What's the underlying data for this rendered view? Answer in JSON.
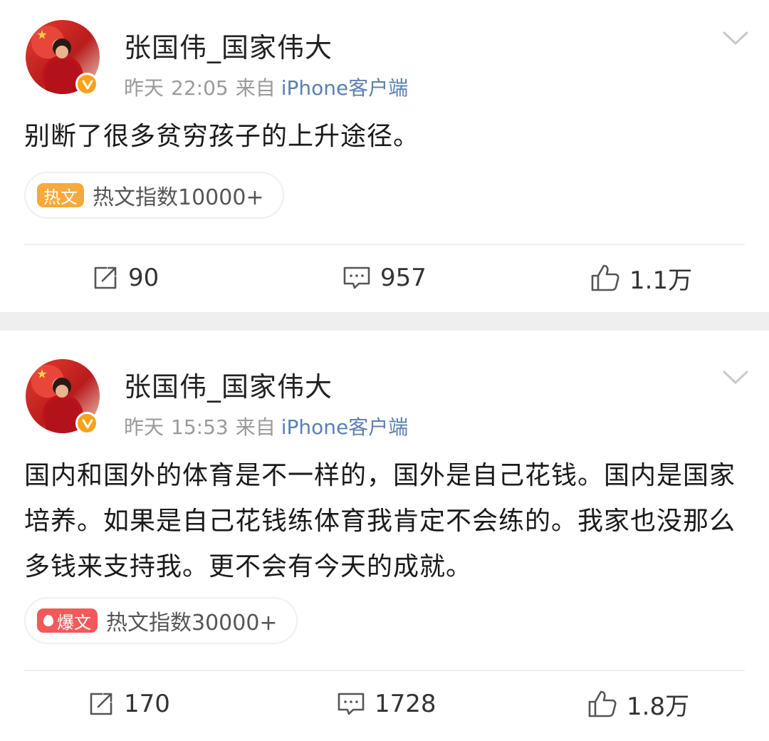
{
  "posts": [
    {
      "username": "张国伟_国家伟大",
      "date": "昨天",
      "time": "22:05",
      "source_prefix": "来自",
      "source": "iPhone客户端",
      "content": "别断了很多贫穷孩子的上升途径。",
      "hot_badge": {
        "label": "热文",
        "color": "#f8a93c",
        "has_flame": false
      },
      "hot_index": "热文指数10000+",
      "repost_count": "90",
      "comment_count": "957",
      "like_count": "1.1万"
    },
    {
      "username": "张国伟_国家伟大",
      "date": "昨天",
      "time": "15:53",
      "source_prefix": "来自",
      "source": "iPhone客户端",
      "content": "国内和国外的体育是不一样的，国外是自己花钱。国内是国家培养。如果是自己花钱练体育我肯定不会练的。我家也没那么多钱来支持我。更不会有今天的成就。",
      "hot_badge": {
        "label": "爆文",
        "color": "#f05a5a",
        "has_flame": true
      },
      "hot_index": "热文指数30000+",
      "repost_count": "170",
      "comment_count": "1728",
      "like_count": "1.8万"
    }
  ],
  "icons": {
    "repost": "repost-icon",
    "comment": "comment-icon",
    "like": "thumbs-up-icon",
    "menu": "chevron-down-icon",
    "verified": "verified-badge-icon"
  },
  "colors": {
    "source_link": "#5b7fb0",
    "verified_badge": "#f7a21b",
    "separator": "#efefef"
  }
}
